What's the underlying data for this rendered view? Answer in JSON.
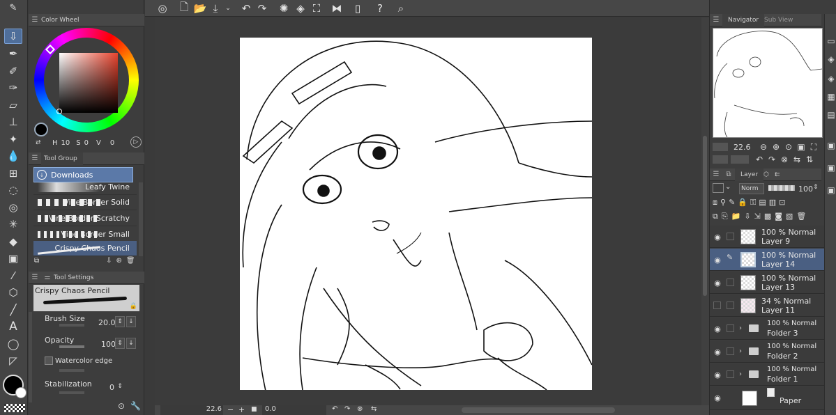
{
  "color_wheel": {
    "tab": "Color Wheel",
    "h_label": "H",
    "h_value": "10",
    "s_label": "S",
    "s_value": "0",
    "v_label": "V",
    "v_value": "0"
  },
  "tool_group": {
    "tab": "Tool Group",
    "group": "Downloads",
    "brushes": [
      "Leafy Twine",
      "Vine Border Solid",
      "Vine Border Scratchy",
      "Vine Border Small",
      "Crispy Chaos Pencil"
    ]
  },
  "tool_settings": {
    "tab": "Tool Settings",
    "tool_name": "Crispy Chaos Pencil",
    "brush_size_label": "Brush Size",
    "brush_size_value": "20.0",
    "opacity_label": "Opacity",
    "opacity_value": "100",
    "watercolor_label": "Watercolor edge",
    "stabilization_label": "Stabilization",
    "stabilization_value": "0"
  },
  "navigator": {
    "tab": "Navigator",
    "tab2": "Sub View",
    "zoom": "22.6"
  },
  "layer_panel": {
    "tab": "Layer",
    "blend_mode": "Norm",
    "opacity": "100",
    "layers": [
      {
        "l1": "100 % Normal",
        "l2": "Layer 9",
        "type": "raster",
        "selected": false,
        "visible": true
      },
      {
        "l1": "100 % Normal",
        "l2": "Layer 14",
        "type": "raster",
        "selected": true,
        "visible": true
      },
      {
        "l1": "100 % Normal",
        "l2": "Layer 13",
        "type": "raster",
        "selected": false,
        "visible": true
      },
      {
        "l1": "34 % Normal",
        "l2": "Layer 11",
        "type": "raster",
        "selected": false,
        "visible": false
      },
      {
        "l1": "100 % Normal",
        "l2": "Folder 3",
        "type": "folder",
        "selected": false,
        "visible": true
      },
      {
        "l1": "100 % Normal",
        "l2": "Folder 2",
        "type": "folder",
        "selected": false,
        "visible": true
      },
      {
        "l1": "100 % Normal",
        "l2": "Folder 1",
        "type": "folder",
        "selected": false,
        "visible": true
      },
      {
        "l1": "",
        "l2": "Paper",
        "type": "paper",
        "selected": false,
        "visible": true
      }
    ]
  },
  "status_bar": {
    "zoom": "22.6",
    "angle": "0.0"
  },
  "colors": {
    "main_color": "#000000",
    "sub_color": "#ffffff",
    "selection": "#4a5f82"
  }
}
